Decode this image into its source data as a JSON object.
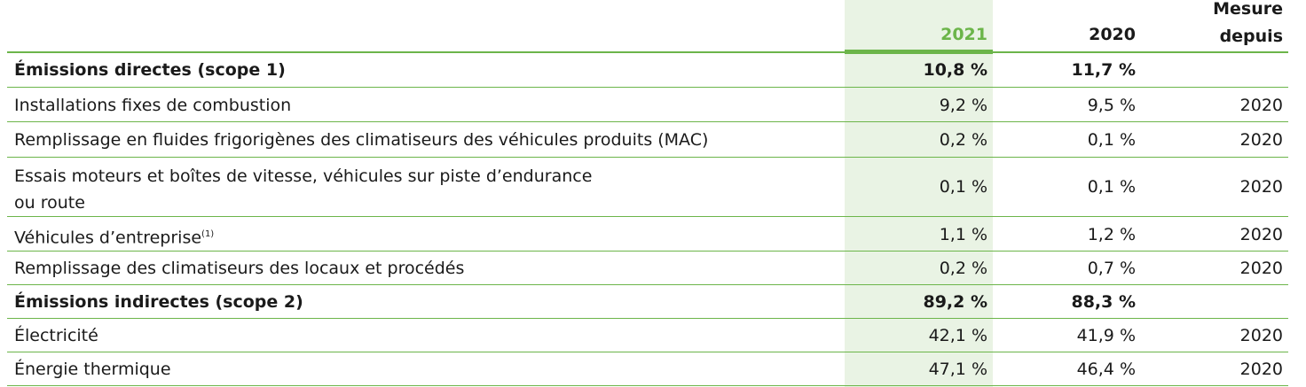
{
  "header": {
    "col_2021": "2021",
    "col_2020": "2020",
    "col_mesure_line1": "Mesure",
    "col_mesure_line2": "depuis"
  },
  "rows": [
    {
      "label": "Émissions directes (scope 1)",
      "v2021": "10,8 %",
      "v2020": "11,7 %",
      "mesure": "",
      "bold": true
    },
    {
      "label": "Installations fixes de combustion",
      "v2021": "9,2 %",
      "v2020": "9,5 %",
      "mesure": "2020"
    },
    {
      "label": "Remplissage en fluides frigorigènes des climatiseurs des véhicules produits (MAC)",
      "v2021": "0,2 %",
      "v2020": "0,1 %",
      "mesure": "2020"
    },
    {
      "label_line1": "Essais moteurs et boîtes de vitesse, véhicules sur piste d’endurance",
      "label_line2": "ou route",
      "v2021": "0,1 %",
      "v2020": "0,1 %",
      "mesure": "2020"
    },
    {
      "label": "Véhicules d’entreprise",
      "note": "(1)",
      "v2021": "1,1 %",
      "v2020": "1,2 %",
      "mesure": "2020"
    },
    {
      "label": "Remplissage des climatiseurs des locaux et procédés",
      "v2021": "0,2 %",
      "v2020": "0,7 %",
      "mesure": "2020"
    },
    {
      "label": "Émissions indirectes (scope 2)",
      "v2021": "89,2 %",
      "v2020": "88,3 %",
      "mesure": "",
      "bold": true
    },
    {
      "label": "Électricité",
      "v2021": "42,1 %",
      "v2020": "41,9 %",
      "mesure": "2020"
    },
    {
      "label": "Énergie thermique",
      "v2021": "47,1 %",
      "v2020": "46,4 %",
      "mesure": "2020"
    }
  ],
  "colors": {
    "accent_green": "#6cb54a",
    "highlight_bg": "#e9f3e4",
    "text": "#1a1a1a"
  }
}
